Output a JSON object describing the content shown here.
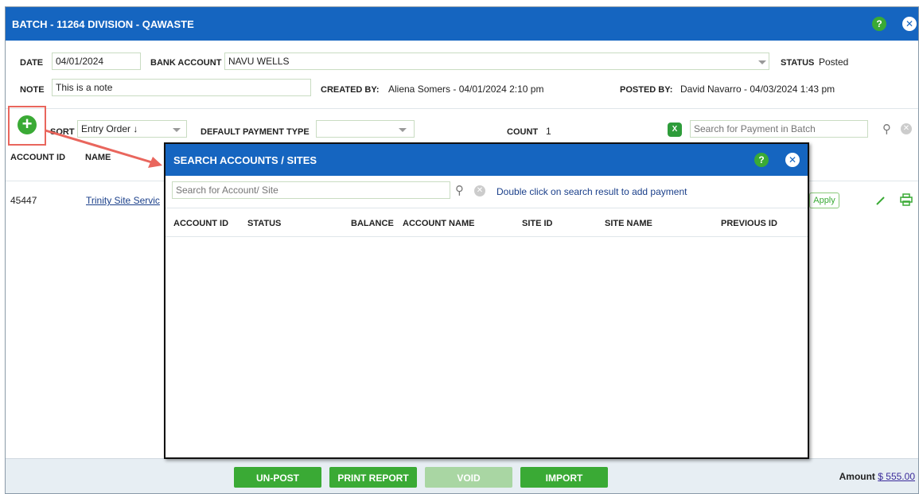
{
  "window": {
    "title": "BATCH - 11264 DIVISION - QAWASTE"
  },
  "form": {
    "date_label": "DATE",
    "date_value": "04/01/2024",
    "bank_label": "BANK ACCOUNT",
    "bank_value": "NAVU WELLS",
    "status_label": "STATUS",
    "status_value": "Posted",
    "note_label": "NOTE",
    "note_value": "This is a note",
    "created_label": "CREATED BY:",
    "created_value": "Aliena Somers - 04/01/2024 2:10 pm",
    "posted_label": "POSTED BY:",
    "posted_value": "David Navarro - 04/03/2024 1:43 pm"
  },
  "toolbar": {
    "sort_label": "SORT",
    "sort_value": "Entry Order ↓",
    "payment_type_label": "DEFAULT PAYMENT TYPE",
    "payment_type_value": "",
    "count_label": "COUNT",
    "count_value": "1",
    "search_placeholder": "Search for Payment in Batch"
  },
  "table": {
    "columns": [
      "ACCOUNT ID",
      "NAME"
    ],
    "rows": [
      {
        "account_id": "45447",
        "name": "Trinity Site Servic",
        "action": "Apply"
      }
    ]
  },
  "footer": {
    "buttons": [
      "UN-POST",
      "PRINT REPORT",
      "VOID",
      "IMPORT"
    ],
    "amount_label": "Amount",
    "amount_value": "$ 555.00"
  },
  "modal": {
    "title": "SEARCH ACCOUNTS / SITES",
    "search_placeholder": "Search for Account/ Site",
    "hint": "Double click on search result to add payment",
    "columns": [
      "ACCOUNT ID",
      "STATUS",
      "BALANCE",
      "ACCOUNT NAME",
      "SITE ID",
      "SITE NAME",
      "PREVIOUS ID"
    ]
  },
  "colors": {
    "primary": "#1565c0",
    "accent_green": "#3aaa35",
    "highlight_red": "#e9665d"
  },
  "icons": [
    "help-icon",
    "close-icon",
    "add-icon",
    "excel-icon",
    "search-icon",
    "clear-icon",
    "edit-icon",
    "print-icon",
    "dropdown-icon"
  ]
}
